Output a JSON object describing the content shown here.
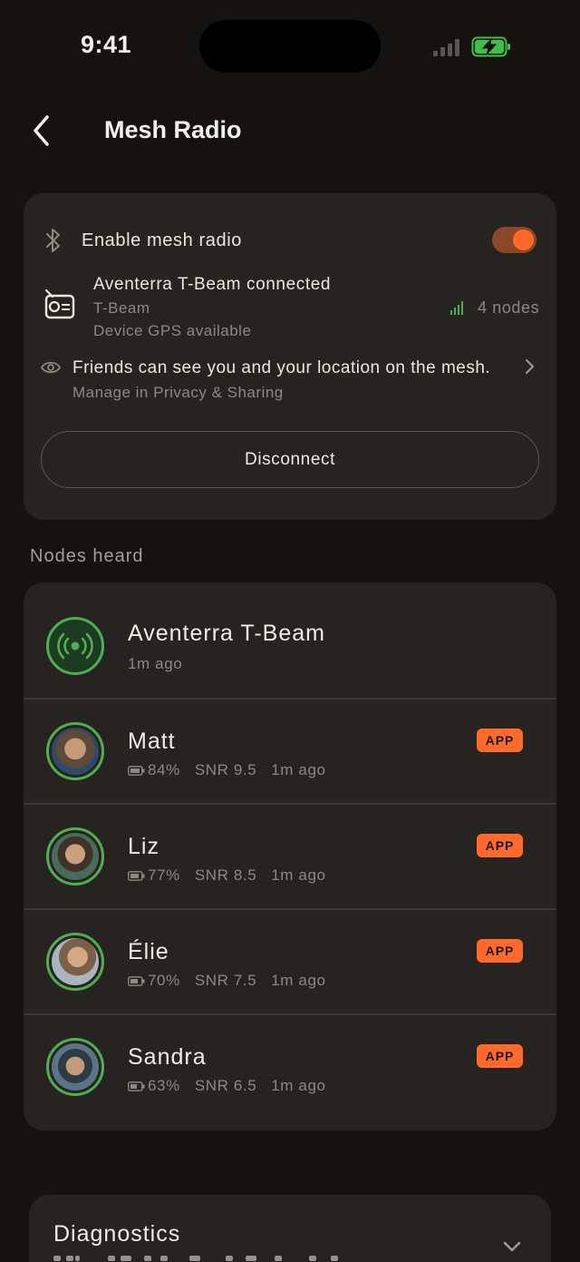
{
  "status_bar": {
    "time": "9:41"
  },
  "nav": {
    "title": "Mesh Radio"
  },
  "mesh": {
    "enable_label": "Enable mesh radio",
    "enabled": true,
    "device_name": "Aventerra T-Beam connected",
    "device_model": "T-Beam",
    "device_gps": "Device GPS available",
    "nodes_count": "4 nodes",
    "privacy_text": "Friends can see you and your location on the mesh.",
    "privacy_sub": "Manage in Privacy & Sharing",
    "disconnect_label": "Disconnect"
  },
  "nodes_section": {
    "title": "Nodes heard"
  },
  "nodes": [
    {
      "name": "Aventerra T-Beam",
      "meta": "1m ago"
    },
    {
      "name": "Matt",
      "battery": "84%",
      "snr": "SNR 9.5",
      "time": "1m ago",
      "badge": "APP"
    },
    {
      "name": "Liz",
      "battery": "77%",
      "snr": "SNR 8.5",
      "time": "1m ago",
      "badge": "APP"
    },
    {
      "name": "Élie",
      "battery": "70%",
      "snr": "SNR 7.5",
      "time": "1m ago",
      "badge": "APP"
    },
    {
      "name": "Sandra",
      "battery": "63%",
      "snr": "SNR 6.5",
      "time": "1m ago",
      "badge": "APP"
    }
  ],
  "diagnostics": {
    "title": "Diagnostics"
  },
  "colors": {
    "accent": "#ff6a2b",
    "online_ring": "#4fae4f",
    "background": "#151311",
    "card": "#272320"
  }
}
